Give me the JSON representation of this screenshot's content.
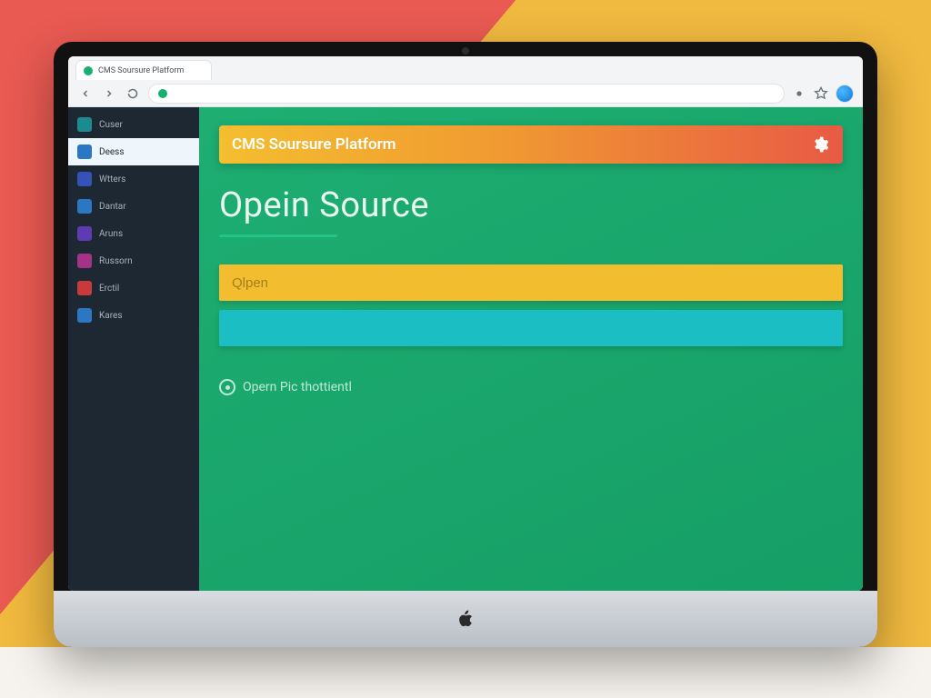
{
  "browser": {
    "tab_label": "CMS Soursure Platform"
  },
  "banner": {
    "title": "CMS Soursure Platform"
  },
  "hero": {
    "heading": "Opein Source"
  },
  "form": {
    "input_placeholder": "Qlpen",
    "button_label": ""
  },
  "footer": {
    "link_text": "Opern Pic thottientl"
  },
  "sidebar": {
    "items": [
      {
        "label": "Cuser",
        "color": "c-teal"
      },
      {
        "label": "Deess",
        "color": "c-blue"
      },
      {
        "label": "Wtters",
        "color": "c-indigo"
      },
      {
        "label": "Dantar",
        "color": "c-blue"
      },
      {
        "label": "Aruns",
        "color": "c-purple"
      },
      {
        "label": "Russorn",
        "color": "c-magenta"
      },
      {
        "label": "Erctil",
        "color": "c-red"
      },
      {
        "label": "Kares",
        "color": "c-blue"
      }
    ],
    "active_index": 1
  }
}
